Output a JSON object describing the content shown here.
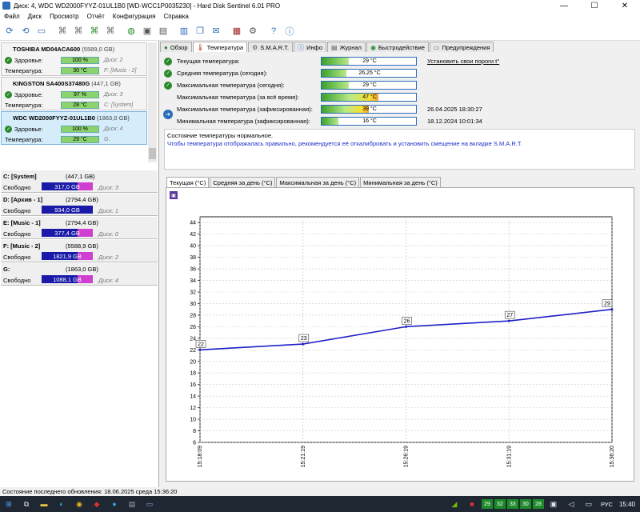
{
  "window": {
    "title": "Диск: 4, WDC WD2000FYYZ-01UL1B0 [WD-WCC1P0035230] - Hard Disk Sentinel 6.01 PRO",
    "minimize": "—",
    "maximize": "☐",
    "close": "✕"
  },
  "menu": [
    "Файл",
    "Диск",
    "Просмотр",
    "Отчёт",
    "Конфигурация",
    "Справка"
  ],
  "disks": [
    {
      "name": "TOSHIBA MD04ACA600",
      "size": "(5589,0 GB)",
      "health_label": "Здоровье:",
      "health": "100 %",
      "health_extra": "Диск: 2",
      "temp_label": "Температура:",
      "temp": "30 °C",
      "temp_extra": "F: [Music - 2]"
    },
    {
      "name": "KINGSTON SA400S37480G",
      "size": "(447,1 GB)",
      "health_label": "Здоровье:",
      "health": "97 %",
      "health_extra": "Диск: 3",
      "temp_label": "Температура:",
      "temp": "28 °C",
      "temp_extra": "C: [System]"
    },
    {
      "name": "WDC WD2000FYYZ-01UL1B0",
      "size": "(1863,0 GB)",
      "health_label": "Здоровье:",
      "health": "100 %",
      "health_extra": "Диск: 4",
      "temp_label": "Температура:",
      "temp": "29 °C",
      "temp_extra": "G:"
    }
  ],
  "volumes": [
    {
      "name": "C: [System]",
      "size": "(447,1 GB)",
      "free_label": "Свободно",
      "free": "317,0 GB",
      "disk": "Диск: 3"
    },
    {
      "name": "D: [Архив - 1]",
      "size": "(2794,4 GB)",
      "free_label": "Свободно",
      "free": "934,0 GB",
      "disk": "Диск: 1"
    },
    {
      "name": "E: [Music - 1]",
      "size": "(2794,4 GB)",
      "free_label": "Свободно",
      "free": "377,4 GB",
      "disk": "Диск: 0"
    },
    {
      "name": "F: [Music - 2]",
      "size": "(5588,9 GB)",
      "free_label": "Свободно",
      "free": "1821,9 GB",
      "disk": "Диск: 2"
    },
    {
      "name": "G:",
      "size": "(1863,0 GB)",
      "free_label": "Свободно",
      "free": "1088,1 GB",
      "disk": "Диск: 4"
    }
  ],
  "tabs": [
    "Обзор",
    "Температура",
    "S.M.A.R.T.",
    "Инфо",
    "Журнал",
    "Быстродействие",
    "Предупреждения"
  ],
  "temps": [
    {
      "label": "Текущая температура:",
      "value": "29 °C",
      "fill": 0.29,
      "icon": "check-icon",
      "note": "Установить свои пороги t°"
    },
    {
      "label": "Средняя температура (сегодня):",
      "value": "26,25 °C",
      "fill": 0.26,
      "icon": "check-icon",
      "note": ""
    },
    {
      "label": "Максимальная температура (сегодня):",
      "value": "29 °C",
      "fill": 0.29,
      "icon": "check-icon",
      "note": ""
    },
    {
      "label": "Максимальная температура (за всё время):",
      "value": "47 °C",
      "fill": 0.6,
      "icon": "",
      "note": ""
    },
    {
      "label": "Максимальная температура (зафиксированная):",
      "value": "39 °C",
      "fill": 0.5,
      "icon": "",
      "note": "26.04.2025 18:30:27"
    },
    {
      "label": "Минимальная температура (зафиксированная):",
      "value": "16 °C",
      "fill": 0.18,
      "icon": "",
      "note": "18.12.2024 10:01:34"
    }
  ],
  "status": {
    "line1": "Состояние температуры нормальное.",
    "line2": "Чтобы температура отображалась правильно, рекомендуется её откалибровать и установить смещение на вкладке S.M.A.R.T."
  },
  "graph_tabs": [
    "Текущая (°C)",
    "Средняя за день (°C)",
    "Максимальная за день (°C)",
    "Минимальная за день (°C)"
  ],
  "chart_data": {
    "type": "line",
    "x": [
      "15:18:09",
      "15:21:19",
      "15:26:19",
      "15:31:19",
      "15:36:20"
    ],
    "values": [
      22,
      23,
      26,
      27,
      29
    ],
    "y_ticks": [
      6,
      8,
      10,
      12,
      14,
      16,
      18,
      20,
      22,
      24,
      26,
      28,
      30,
      32,
      34,
      36,
      38,
      40,
      42,
      44
    ],
    "ylim": [
      6,
      45
    ],
    "grid": true,
    "colors": {
      "line": "#1f1fc8"
    }
  },
  "statusbar": "Состояние последнего обновления: 18.06.2025 среда 15:36:20",
  "taskbar": {
    "tray_temps": [
      "29",
      "32",
      "33",
      "30",
      "28"
    ],
    "lang": "РУС",
    "time": "15:40"
  }
}
